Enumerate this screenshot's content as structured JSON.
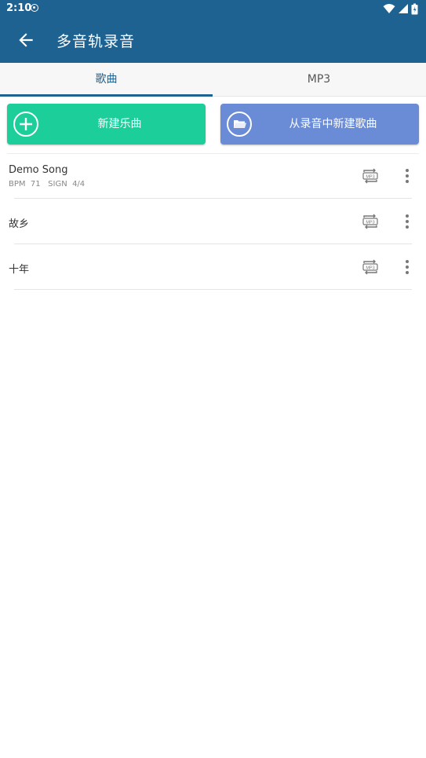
{
  "status": {
    "time": "2:10"
  },
  "appbar": {
    "title": "多音轨录音"
  },
  "tabs": [
    {
      "label": "歌曲",
      "active": true
    },
    {
      "label": "MP3",
      "active": false
    }
  ],
  "actions": {
    "new_song": "新建乐曲",
    "from_recording": "从录音中新建歌曲"
  },
  "songs": [
    {
      "title": "Demo Song",
      "bpm_label": "BPM",
      "bpm": "71",
      "sign_label": "SIGN",
      "sign": "4/4"
    },
    {
      "title": "故乡"
    },
    {
      "title": "十年"
    }
  ],
  "colors": {
    "primary": "#1d6291",
    "green": "#1ccf9a",
    "blue": "#6a8bd6"
  }
}
